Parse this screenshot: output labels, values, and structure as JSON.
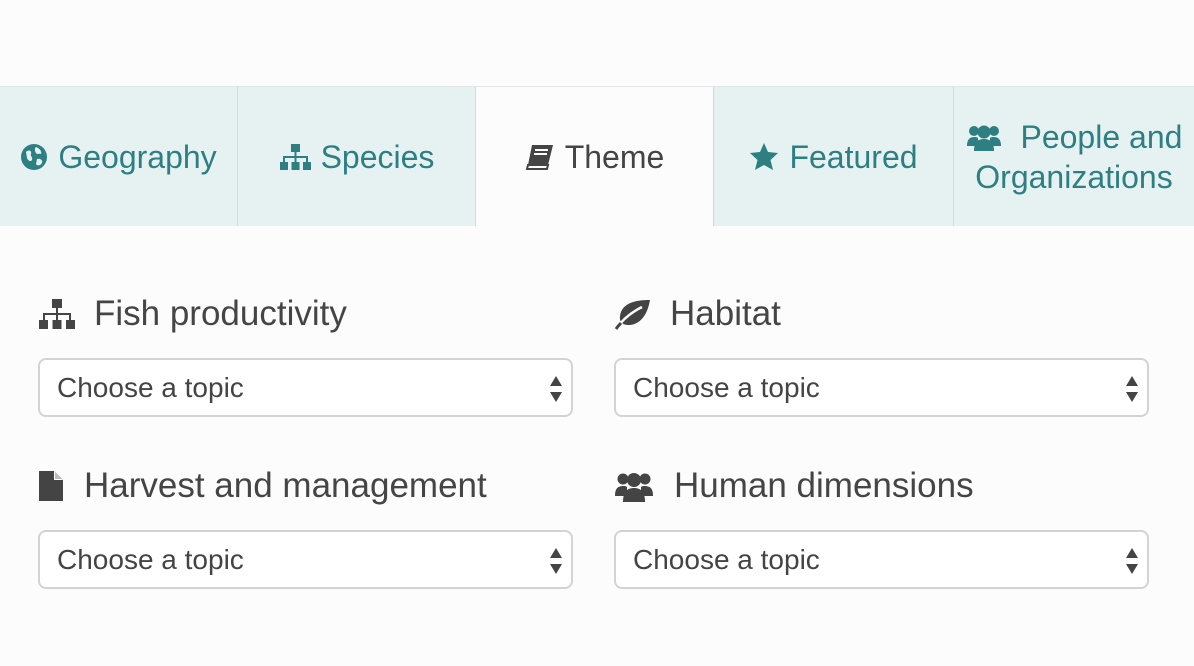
{
  "tabs": [
    {
      "label": "Geography",
      "icon": "globe-icon",
      "active": false
    },
    {
      "label": "Species",
      "icon": "sitemap-icon",
      "active": false
    },
    {
      "label": "Theme",
      "icon": "book-icon",
      "active": true
    },
    {
      "label": "Featured",
      "icon": "star-icon",
      "active": false
    },
    {
      "label_line1": "People and",
      "label_line2": "Organizations",
      "icon": "users-icon",
      "active": false
    }
  ],
  "sections": [
    {
      "title": "Fish productivity",
      "icon": "sitemap-icon",
      "select": {
        "value": "Choose a topic"
      }
    },
    {
      "title": "Habitat",
      "icon": "leaf-icon",
      "select": {
        "value": "Choose a topic"
      }
    },
    {
      "title": "Harvest and management",
      "icon": "file-icon",
      "select": {
        "value": "Choose a topic"
      }
    },
    {
      "title": "Human dimensions",
      "icon": "users-icon",
      "select": {
        "value": "Choose a topic"
      }
    }
  ],
  "colors": {
    "tab_background": "#e6f1f2",
    "tab_text": "#2e7f82",
    "active_tab_text": "#444444",
    "heading_text": "#454545"
  }
}
